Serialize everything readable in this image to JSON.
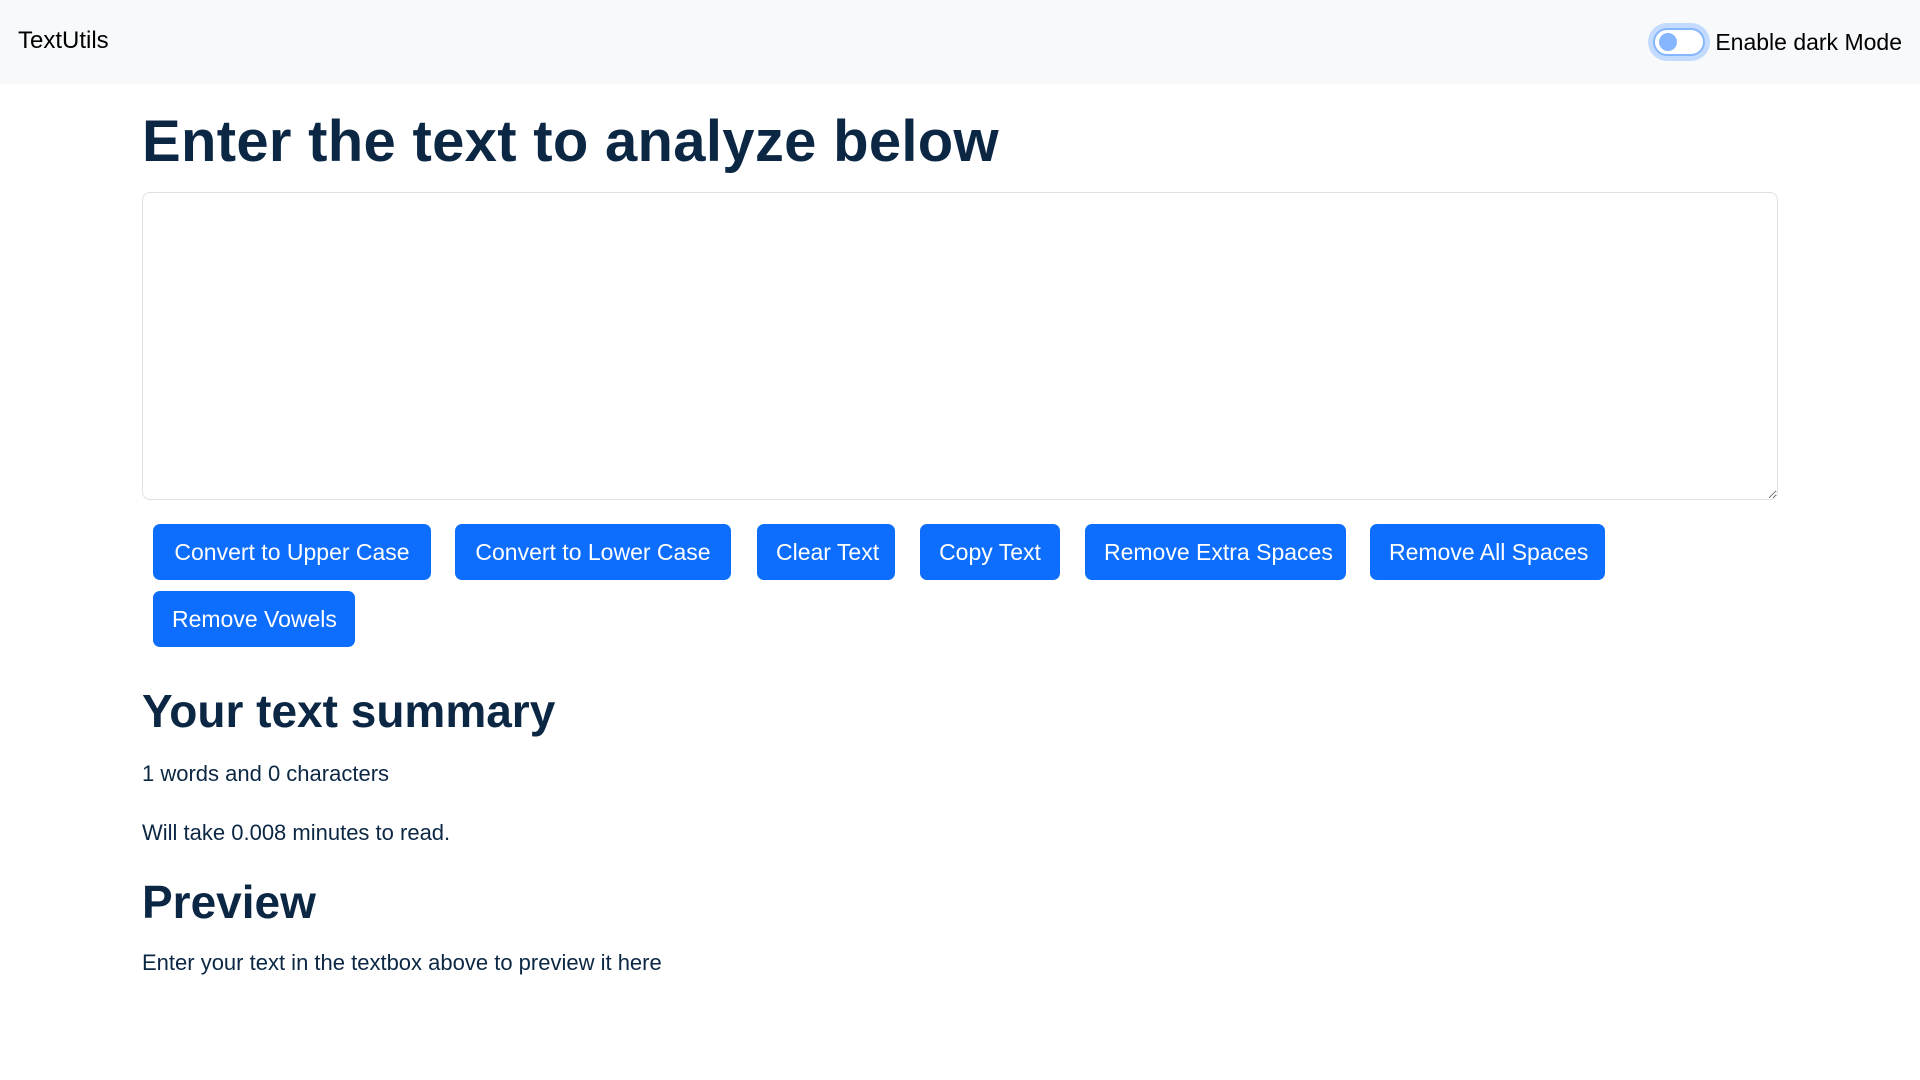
{
  "navbar": {
    "brand": "TextUtils",
    "dark_mode_toggle": {
      "label": "Enable dark Mode",
      "checked": false
    }
  },
  "main": {
    "heading": "Enter the text to analyze below",
    "textarea": {
      "value": "",
      "placeholder": ""
    },
    "buttons": [
      {
        "label": "Convert to Upper Case"
      },
      {
        "label": "Convert to Lower Case"
      },
      {
        "label": "Clear Text"
      },
      {
        "label": "Copy Text"
      },
      {
        "label": "Remove Extra Spaces"
      },
      {
        "label": "Remove All Spaces"
      },
      {
        "label": "Remove Vowels"
      }
    ],
    "summary": {
      "heading": "Your text summary",
      "counts": "1 words and 0 characters",
      "read_time": "Will take 0.008 minutes to read."
    },
    "preview": {
      "heading": "Preview",
      "text": "Enter your text in the textbox above to preview it here"
    }
  },
  "colors": {
    "primary": "#0d6efd",
    "navbar_bg": "#f8f9fa",
    "heading_text": "#0b2744"
  }
}
